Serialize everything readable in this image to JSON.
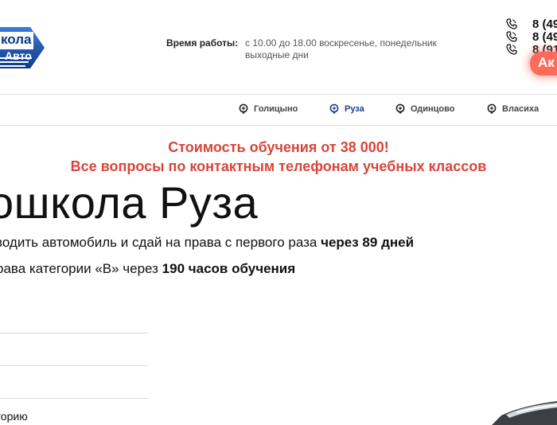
{
  "logo": {
    "line1": "кола",
    "line2": "Авто"
  },
  "header": {
    "hours_label": "Время работы:",
    "hours_value": "с 10.00 до 18.00 воскресенье, понедельник выходные дни",
    "phones": [
      "8 (49",
      "8 (49",
      "8 (91"
    ],
    "promo_label": "Ак"
  },
  "nav": {
    "items": [
      {
        "label": "Голицыно",
        "active": false
      },
      {
        "label": "Руза",
        "active": true
      },
      {
        "label": "Одинцово",
        "active": false
      },
      {
        "label": "Власиха",
        "active": false
      }
    ]
  },
  "promo": {
    "line1": "Стоимость обучения от 38 000!",
    "line2": "Все вопросы по контактным телефонам учебных классов"
  },
  "main": {
    "title": "ошкола Руза",
    "sub1_text": "водить автомобиль и сдай на права с первого раза ",
    "sub1_bold": "через 89 дней",
    "sub2_text": "рава категории «В» через ",
    "sub2_bold": "190 часов обучения",
    "category_label": "горию"
  },
  "colors": {
    "accent_red": "#d9453a",
    "nav_active": "#1a3f8f",
    "logo_blue": "#0e3a8c",
    "promo_badge": "#ff6b5b"
  }
}
